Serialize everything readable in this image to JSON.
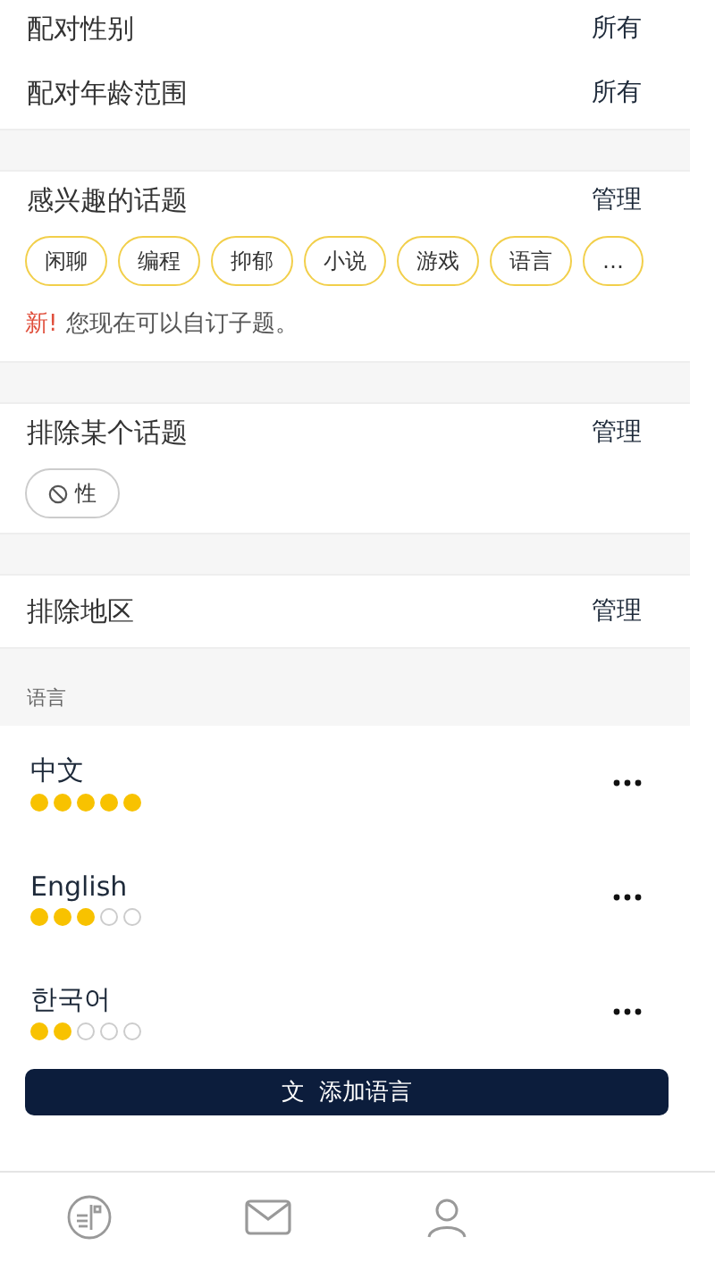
{
  "match_rows": [
    {
      "label": "配对性别",
      "value": "所有"
    },
    {
      "label": "配对年龄范围",
      "value": "所有"
    }
  ],
  "interests": {
    "title": "感兴趣的话题",
    "action": "管理",
    "tags": [
      "闲聊",
      "编程",
      "抑郁",
      "小说",
      "游戏",
      "语言",
      "…"
    ],
    "new_badge": "新!",
    "note": "您现在可以自订子题。"
  },
  "excluded_topics": {
    "title": "排除某个话题",
    "action": "管理",
    "tags": [
      "性"
    ]
  },
  "excluded_regions": {
    "title": "排除地区",
    "action": "管理"
  },
  "languages": {
    "header": "语言",
    "items": [
      {
        "name": "中文",
        "stars": 5
      },
      {
        "name": "English",
        "stars": 3
      },
      {
        "name": "한국어",
        "stars": 2
      }
    ],
    "add_icon": "文",
    "add_button": "添加语言"
  },
  "tab_bar": [
    {
      "kind": "card",
      "selected": false
    },
    {
      "kind": "mail",
      "selected": false
    },
    {
      "kind": "person",
      "selected": false
    }
  ]
}
